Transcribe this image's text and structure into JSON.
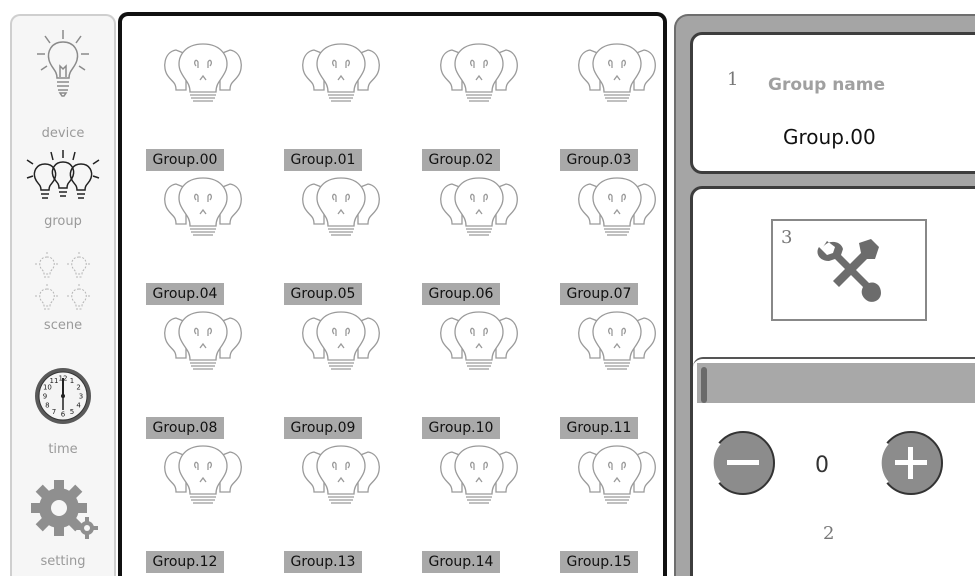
{
  "sidebar": {
    "items": [
      {
        "id": "device",
        "label": "device",
        "icon": "bulb-icon"
      },
      {
        "id": "group",
        "label": "group",
        "icon": "group-bulbs-icon"
      },
      {
        "id": "scene",
        "label": "scene",
        "icon": "scene-bulbs-icon"
      },
      {
        "id": "time",
        "label": "time",
        "icon": "clock-icon"
      },
      {
        "id": "setting",
        "label": "setting",
        "icon": "gear-icon"
      }
    ],
    "clock_numbers": [
      "12",
      "1",
      "2",
      "3",
      "4",
      "5",
      "6",
      "7",
      "8",
      "9",
      "10",
      "11"
    ],
    "selected": "group"
  },
  "groups": [
    {
      "label": "Group.00"
    },
    {
      "label": "Group.01"
    },
    {
      "label": "Group.02"
    },
    {
      "label": "Group.03"
    },
    {
      "label": "Group.04"
    },
    {
      "label": "Group.05"
    },
    {
      "label": "Group.06"
    },
    {
      "label": "Group.07"
    },
    {
      "label": "Group.08"
    },
    {
      "label": "Group.09"
    },
    {
      "label": "Group.10"
    },
    {
      "label": "Group.11"
    },
    {
      "label": "Group.12"
    },
    {
      "label": "Group.13"
    },
    {
      "label": "Group.14"
    },
    {
      "label": "Group.15"
    }
  ],
  "right_panel": {
    "name_card": {
      "marker": "1",
      "title": "Group name",
      "value": "Group.00"
    },
    "tools": {
      "marker": "3",
      "icon": "wrench-screwdriver-icon"
    },
    "brightness": {
      "marker": "2",
      "value": "0",
      "level": 0
    }
  },
  "colors": {
    "label_bg": "#a9a9a9",
    "panel_bg": "#a5a5a5",
    "frame": "#111111"
  }
}
